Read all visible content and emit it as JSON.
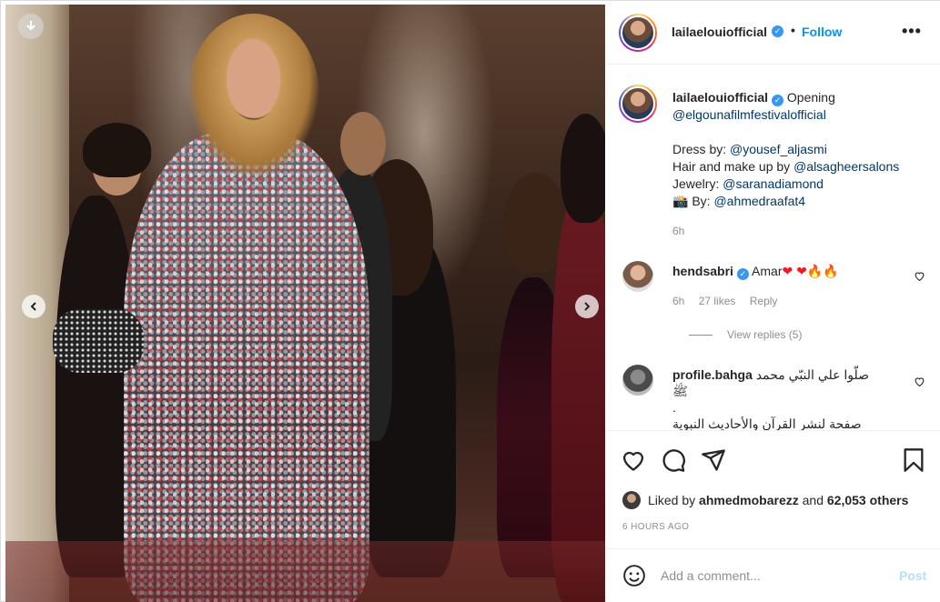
{
  "post": {
    "author": "lailaelouiofficial",
    "follow_label": "Follow",
    "separator": "•",
    "more_label": "•••"
  },
  "caption": {
    "author": "lailaelouiofficial",
    "text_lead": "Opening",
    "mention_festival": "@elgounafilmfestivalofficial",
    "dress_label": "Dress by: ",
    "dress_mention": "@yousef_aljasmi",
    "hair_label": "Hair and make up by ",
    "hair_mention": "@alsagheersalons",
    "jewelry_label": "Jewelry: ",
    "jewelry_mention": "@saranadiamond",
    "photo_emoji": "📸",
    "photo_label": " By: ",
    "photo_mention": "@ahmedraafat4",
    "time": "6h"
  },
  "comments": [
    {
      "author": "hendsabri",
      "text": "Amar",
      "emojis": [
        "❤",
        "❤",
        "🔥",
        "🔥"
      ],
      "time": "6h",
      "likes": "27 likes",
      "reply_label": "Reply",
      "view_replies": "View replies (5)"
    },
    {
      "author": "profile.bahga",
      "text_line1": "صلّوا علي النبّي محمد",
      "text_line2": "ﷺ",
      "text_line3": ".",
      "text_line4": "صفحة لنشر القرآن والأحاديث النبوية"
    }
  ],
  "actions": {
    "liked_by_prefix": "Liked by ",
    "liked_by_user": "ahmedmobarezz",
    "liked_by_middle": " and ",
    "liked_by_count": "62,053 others",
    "time_ago": "6 HOURS AGO"
  },
  "add_comment": {
    "placeholder": "Add a comment...",
    "post_label": "Post"
  },
  "icons": {
    "download": "download-icon",
    "prev": "chevron-left-icon",
    "next": "chevron-right-icon",
    "like": "heart-icon",
    "comment": "comment-icon",
    "share": "paper-plane-icon",
    "save": "bookmark-icon",
    "emoji": "smiley-icon",
    "verified": "verified-badge-icon"
  },
  "colors": {
    "accent": "#0095f6",
    "link": "#00376b",
    "muted": "#8e8e8e",
    "post_disabled": "#b2dffc",
    "verified": "#3897f0"
  }
}
